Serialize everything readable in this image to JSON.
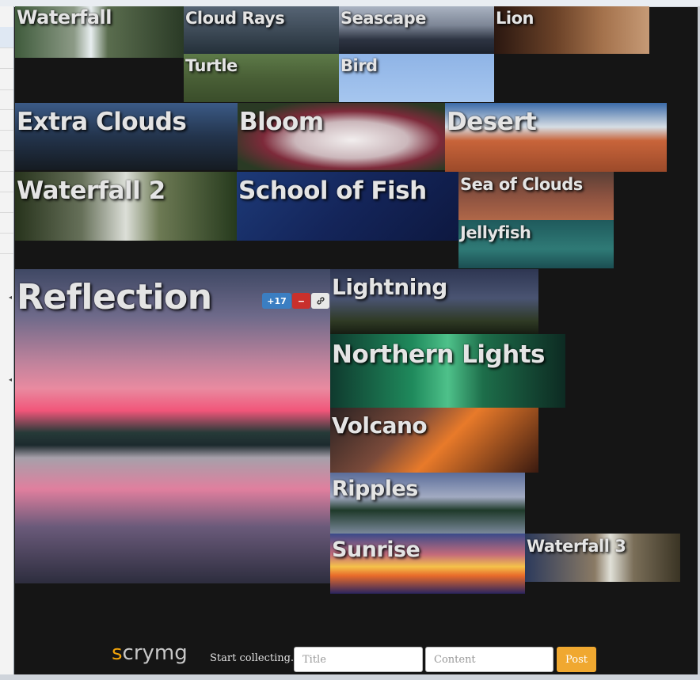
{
  "app": {
    "logo_s": "s",
    "logo_rest": "crymg",
    "tagline": "Start collecting.",
    "title_placeholder": "Title",
    "content_placeholder": "Content",
    "post_label": "Post"
  },
  "reflection_controls": {
    "vote_label": "+17",
    "minus_label": "−",
    "link_icon": "link-icon"
  },
  "tiles": [
    {
      "name": "waterfall",
      "label": "Waterfall",
      "bg": "linear-gradient(90deg,#3f5b3c 0%,#8c9a86 35%,#e8eef0 45%,#5a6d4e 55%,#2a3a26 100%)"
    },
    {
      "name": "cloud-rays",
      "label": "Cloud Rays",
      "bg": "linear-gradient(180deg,#566474 0%,#3e4b58 50%,#24303a 100%)"
    },
    {
      "name": "seascape",
      "label": "Seascape",
      "bg": "linear-gradient(180deg,#aab3c2 0%,#7d8696 40%,#2d3442 70%,#1c222c 100%)"
    },
    {
      "name": "lion",
      "label": "Lion",
      "bg": "linear-gradient(90deg,#2a1710 0%,#6b4228 40%,#a4724c 70%,#c69a76 100%)"
    },
    {
      "name": "turtle",
      "label": "Turtle",
      "bg": "linear-gradient(180deg,#5d7a48 0%,#495f36 50%,#3a4d2a 100%)"
    },
    {
      "name": "bird",
      "label": "Bird",
      "bg": "linear-gradient(180deg,#8fb4e6 0%,#a6c6ef 100%)"
    },
    {
      "name": "extra-clouds",
      "label": "Extra Clouds",
      "bg": "linear-gradient(180deg,#3b5a86 0%,#23344c 50%,#151b22 100%)"
    },
    {
      "name": "bloom",
      "label": "Bloom",
      "bg": "radial-gradient(ellipse at 55% 55%,#f2eeee 0%,#cbb7bb 35%,#7d2a3a 55%,#2a3a24 80%)"
    },
    {
      "name": "desert",
      "label": "Desert",
      "bg": "linear-gradient(180deg,#3a6aa8 0%,#d6dde4 35%,#c8643a 55%,#9c4a2a 100%)"
    },
    {
      "name": "waterfall-2",
      "label": "Waterfall 2",
      "bg": "linear-gradient(90deg,#27331c 0%,#667059 30%,#dcdfd8 50%,#6d7a54 65%,#263a1d 100%)"
    },
    {
      "name": "school-of-fish",
      "label": "School of Fish",
      "bg": "linear-gradient(135deg,#1d3a78 0%,#14255a 50%,#0d1840 100%)"
    },
    {
      "name": "sea-of-clouds",
      "label": "Sea of Clouds",
      "bg": "linear-gradient(180deg,#5a3f36 0%,#8c5240 50%,#b06748 100%)"
    },
    {
      "name": "jellyfish",
      "label": "Jellyfish",
      "bg": "linear-gradient(180deg,#1f5a5c 0%,#2f7a76 60%,#1b4e52 100%)"
    },
    {
      "name": "reflection",
      "label": "Reflection",
      "bg": "linear-gradient(180deg,#3f4864 0%,#6e6a8a 15%,#c1839c 30%,#e98aa0 38%,#f1567a 45%,#263a38 52%,#1c2a2e 56%,#a6a0aa 60%,#e07f9e 70%,#6a5a7a 82%,#2d2d3e 100%)"
    },
    {
      "name": "lightning",
      "label": "Lightning",
      "bg": "linear-gradient(180deg,#2e3652 0%,#4a5472 45%,#2f3a24 80%,#161c12 100%)"
    },
    {
      "name": "northern-lights",
      "label": "Northern Lights",
      "bg": "linear-gradient(90deg,#0f3a2e 0%,#1f8a5c 35%,#4ec18a 50%,#1d6e4a 65%,#0d2a22 100%)"
    },
    {
      "name": "volcano",
      "label": "Volcano",
      "bg": "linear-gradient(135deg,#2a2222 0%,#7a4a3a 35%,#e87a2a 55%,#3a1a10 100%)"
    },
    {
      "name": "ripples",
      "label": "Ripples",
      "bg": "linear-gradient(180deg,#5b6d9a 0%,#a2aac2 40%,#1f3a2a 62%,#7a889a 100%)"
    },
    {
      "name": "sunrise",
      "label": "Sunrise",
      "bg": "linear-gradient(180deg,#3a4a8a 0%,#c46b7a 35%,#f5c24a 55%,#e86a2a 70%,#2a2460 100%)"
    },
    {
      "name": "waterfall-3",
      "label": "Waterfall 3",
      "bg": "linear-gradient(90deg,#2c3a5c 0%,#8a7a64 45%,#e0e0d8 55%,#7a6e58 70%,#3a3424 100%)"
    }
  ]
}
